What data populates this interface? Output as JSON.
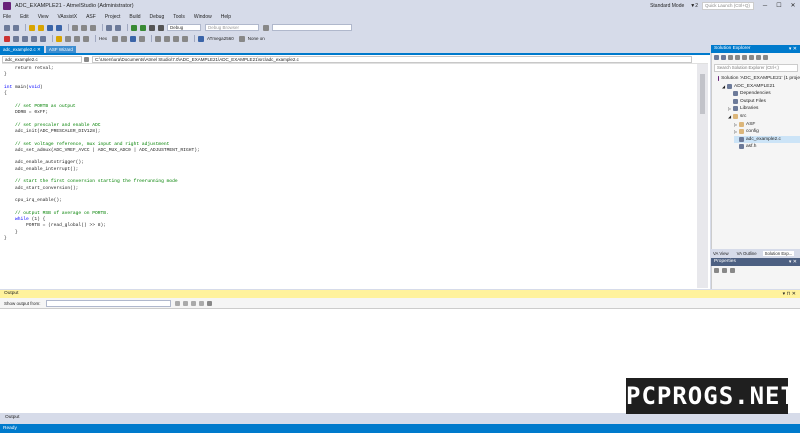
{
  "window": {
    "title": "ADC_EXAMPLE21 - AtmelStudio (Administrator)",
    "mode": "Standard Mode",
    "filter_count": "▼2",
    "quicklaunch_placeholder": "Quick Launch (Ctrl+Q)",
    "minimize": "─",
    "maximize": "☐",
    "close": "✕"
  },
  "menu": [
    "File",
    "Edit",
    "View",
    "VAssistX",
    "ASF",
    "Project",
    "Build",
    "Debug",
    "Tools",
    "Window",
    "Help"
  ],
  "toolbar": {
    "config": "Debug",
    "browser": "Debug Browser",
    "hex_label": "Hex",
    "device": "ATmega2560",
    "tool": "None on"
  },
  "tabs": [
    {
      "label": "adc_example2.c",
      "active": true
    },
    {
      "label": "ASF Wizard",
      "active": false
    }
  ],
  "navbar": {
    "file": "adc_example2.c",
    "path": "C:\\Users\\ura\\Documents\\Atmel Studio\\7.0\\ADC_EXAMPLE21\\ADC_EXAMPLE21\\src\\adc_example2.c"
  },
  "code_lines": [
    {
      "text": "    return retval;",
      "kind": "code"
    },
    {
      "text": "}",
      "kind": "code"
    },
    {
      "text": "",
      "kind": "code"
    },
    {
      "text": "int main(void)",
      "kind": "decl"
    },
    {
      "text": "{",
      "kind": "code"
    },
    {
      "text": "",
      "kind": "code"
    },
    {
      "text": "    // set PORTB as output",
      "kind": "comment"
    },
    {
      "text": "    DDRB = 0xFF;",
      "kind": "code"
    },
    {
      "text": "",
      "kind": "code"
    },
    {
      "text": "    // set prescaler and enable ADC",
      "kind": "comment"
    },
    {
      "text": "    adc_init(ADC_PRESCALER_DIV128);",
      "kind": "code"
    },
    {
      "text": "",
      "kind": "code"
    },
    {
      "text": "    // set voltage reference, mux input and right adjustment",
      "kind": "comment"
    },
    {
      "text": "    adc_set_admux(ADC_VREF_AVCC | ADC_MUX_ADC0 | ADC_ADJUSTMENT_RIGHT);",
      "kind": "code"
    },
    {
      "text": "",
      "kind": "code"
    },
    {
      "text": "    adc_enable_autotrigger();",
      "kind": "code"
    },
    {
      "text": "    adc_enable_interrupt();",
      "kind": "code"
    },
    {
      "text": "",
      "kind": "code"
    },
    {
      "text": "    // start the first conversion starting the freerunning mode",
      "kind": "comment"
    },
    {
      "text": "    adc_start_conversion();",
      "kind": "code"
    },
    {
      "text": "",
      "kind": "code"
    },
    {
      "text": "    cpu_irq_enable();",
      "kind": "code"
    },
    {
      "text": "",
      "kind": "code"
    },
    {
      "text": "    // output MSB of average on PORTB.",
      "kind": "comment"
    },
    {
      "text": "    while (1) {",
      "kind": "while"
    },
    {
      "text": "        PORTB = (read_global() >> 8);",
      "kind": "code"
    },
    {
      "text": "    }",
      "kind": "code"
    },
    {
      "text": "}",
      "kind": "code"
    }
  ],
  "solution_explorer": {
    "title": "Solution Explorer",
    "search_placeholder": "Search Solution Explorer (Ctrl+;)",
    "items": [
      {
        "label": "Solution 'ADC_EXAMPLE21' (1 proje",
        "indent": 0,
        "selected": false,
        "arrow": ""
      },
      {
        "label": "ADC_EXAMPLE21",
        "indent": 1,
        "selected": false,
        "arrow": "◢"
      },
      {
        "label": "Dependencies",
        "indent": 2,
        "selected": false,
        "arrow": ""
      },
      {
        "label": "Output Files",
        "indent": 2,
        "selected": false,
        "arrow": ""
      },
      {
        "label": "Libraries",
        "indent": 2,
        "selected": false,
        "arrow": "▷"
      },
      {
        "label": "src",
        "indent": 2,
        "selected": false,
        "arrow": "◢"
      },
      {
        "label": "ASF",
        "indent": 3,
        "selected": false,
        "arrow": "▷"
      },
      {
        "label": "config",
        "indent": 3,
        "selected": false,
        "arrow": "▷"
      },
      {
        "label": "adc_example2.c",
        "indent": 3,
        "selected": true,
        "arrow": ""
      },
      {
        "label": "asf.h",
        "indent": 3,
        "selected": false,
        "arrow": ""
      }
    ],
    "tabs": [
      "VA View",
      "VA Outline",
      "Solution Exp..."
    ]
  },
  "properties": {
    "title": "Properties"
  },
  "output": {
    "title": "Output",
    "show_from_label": "Show output from:",
    "tab_label": "Output"
  },
  "status": {
    "text": "Ready"
  },
  "watermark": "PCPROGS.NET",
  "colors": {
    "accent": "#007acc",
    "output_header": "#fff29d"
  }
}
